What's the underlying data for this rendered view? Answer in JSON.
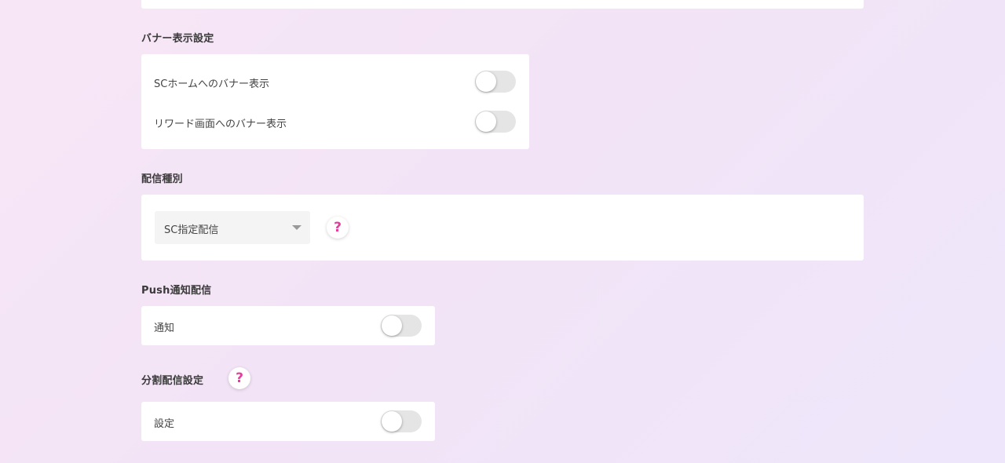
{
  "colors": {
    "accent": "#e0409a",
    "card": "#ffffff",
    "toggle_off": "#e5e5e5",
    "select_bg": "#f4f4f4"
  },
  "banner_section": {
    "title": "バナー表示設定",
    "rows": [
      {
        "label": "SCホームへのバナー表示",
        "enabled": false
      },
      {
        "label": "リワード画面へのバナー表示",
        "enabled": false
      }
    ]
  },
  "delivery_type": {
    "title": "配信種別",
    "select_value": "SC指定配信",
    "help_icon": "question-mark-icon",
    "help_glyph": "?"
  },
  "push_section": {
    "title": "Push通知配信",
    "row": {
      "label": "通知",
      "enabled": false
    }
  },
  "split_section": {
    "title": "分割配信設定",
    "help_glyph": "?",
    "row": {
      "label": "設定",
      "enabled": false
    }
  }
}
